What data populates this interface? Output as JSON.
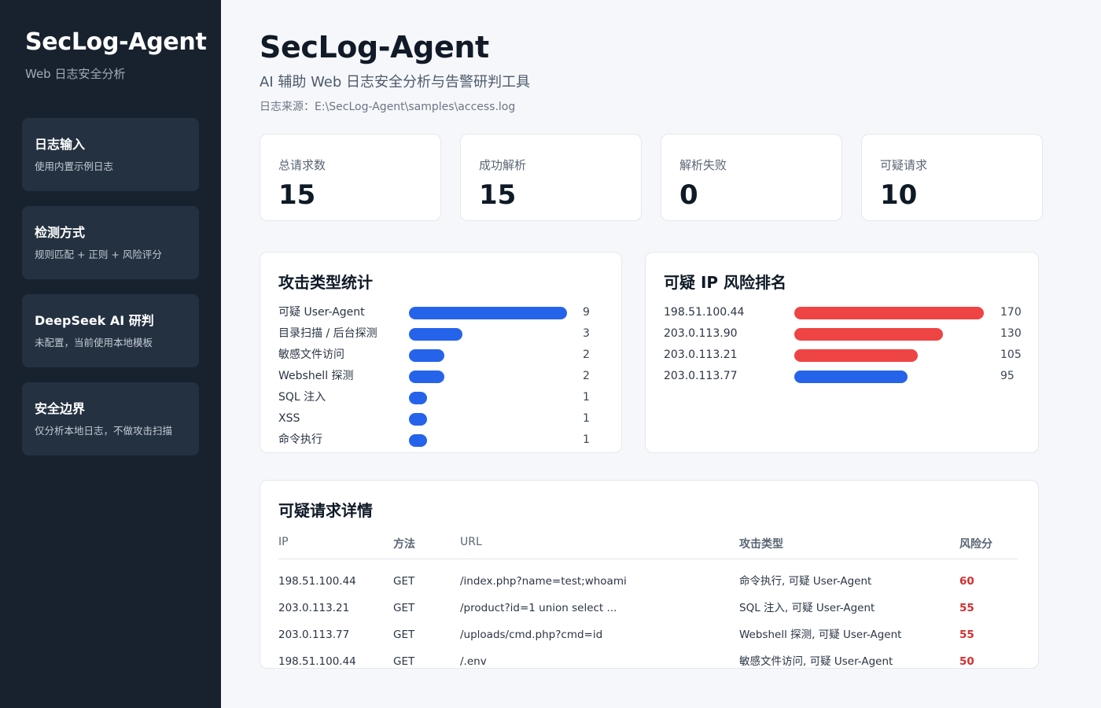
{
  "sidebar": {
    "title": "SecLog-Agent",
    "subtitle": "Web 日志安全分析",
    "cards": [
      {
        "title": "日志输入",
        "desc": "使用内置示例日志"
      },
      {
        "title": "检测方式",
        "desc": "规则匹配 + 正则 + 风险评分"
      },
      {
        "title": "DeepSeek AI 研判",
        "desc": "未配置，当前使用本地模板"
      },
      {
        "title": "安全边界",
        "desc": "仅分析本地日志，不做攻击扫描"
      }
    ]
  },
  "header": {
    "title": "SecLog-Agent",
    "subtitle": "AI 辅助 Web 日志安全分析与告警研判工具",
    "source": "日志来源：E:\\SecLog-Agent\\samples\\access.log"
  },
  "stats": [
    {
      "label": "总请求数",
      "value": "15"
    },
    {
      "label": "成功解析",
      "value": "15"
    },
    {
      "label": "解析失败",
      "value": "0"
    },
    {
      "label": "可疑请求",
      "value": "10"
    }
  ],
  "attack_panel": {
    "title": "攻击类型统计",
    "items": [
      {
        "label": "可疑 User-Agent",
        "value": 9
      },
      {
        "label": "目录扫描 / 后台探测",
        "value": 3
      },
      {
        "label": "敏感文件访问",
        "value": 2
      },
      {
        "label": "Webshell 探测",
        "value": 2
      },
      {
        "label": "SQL 注入",
        "value": 1
      },
      {
        "label": "XSS",
        "value": 1
      },
      {
        "label": "命令执行",
        "value": 1
      }
    ],
    "bar_color": "#2563eb"
  },
  "ip_panel": {
    "title": "可疑 IP 风险排名",
    "items": [
      {
        "label": "198.51.100.44",
        "value": 170,
        "color": "#ef4444"
      },
      {
        "label": "203.0.113.90",
        "value": 130,
        "color": "#ef4444"
      },
      {
        "label": "203.0.113.21",
        "value": 105,
        "color": "#ef4444"
      },
      {
        "label": "203.0.113.77",
        "value": 95,
        "color": "#2563eb"
      }
    ]
  },
  "detail_panel": {
    "title": "可疑请求详情",
    "headers": {
      "ip": "IP",
      "method": "方法",
      "url": "URL",
      "attack": "攻击类型",
      "score": "风险分"
    },
    "rows": [
      {
        "ip": "198.51.100.44",
        "method": "GET",
        "url": "/index.php?name=test;whoami",
        "attack": "命令执行, 可疑 User-Agent",
        "score": "60"
      },
      {
        "ip": "203.0.113.21",
        "method": "GET",
        "url": "/product?id=1 union select ...",
        "attack": "SQL 注入, 可疑 User-Agent",
        "score": "55"
      },
      {
        "ip": "203.0.113.77",
        "method": "GET",
        "url": "/uploads/cmd.php?cmd=id",
        "attack": "Webshell 探测, 可疑 User-Agent",
        "score": "55"
      },
      {
        "ip": "198.51.100.44",
        "method": "GET",
        "url": "/.env",
        "attack": "敏感文件访问, 可疑 User-Agent",
        "score": "50"
      }
    ]
  },
  "colors": {
    "sidebar_bg": "#18222f",
    "accent_blue": "#2563eb",
    "risk_red": "#ef4444",
    "score_red": "#d32f2f"
  }
}
